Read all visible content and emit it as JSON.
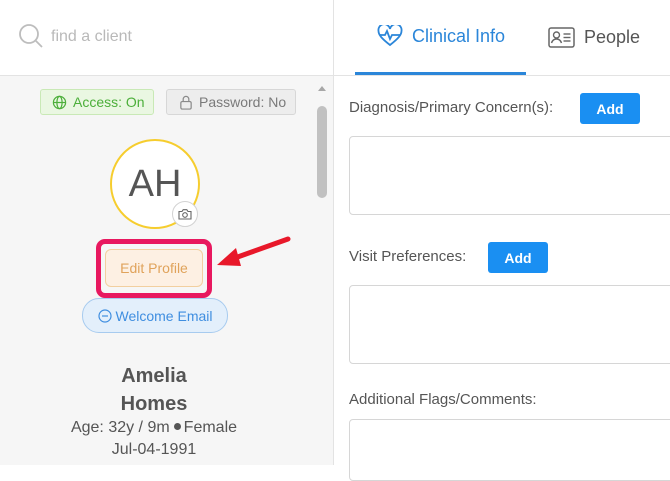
{
  "search": {
    "placeholder": "find a client"
  },
  "badges": {
    "access": "Access: On",
    "password": "Password: No"
  },
  "profile": {
    "initials": "AH",
    "first_name": "Amelia",
    "last_name": "Homes",
    "age_text": "Age: 32y / 9m",
    "gender": "Female",
    "dob": "Jul-04-1991"
  },
  "buttons": {
    "edit_profile": "Edit Profile",
    "welcome_email": "Welcome Email"
  },
  "tabs": [
    {
      "label": "Clinical Info",
      "active": true,
      "icon": "heartbeat-icon"
    },
    {
      "label": "People",
      "active": false,
      "icon": "contact-card-icon"
    }
  ],
  "fields": {
    "diagnosis": {
      "label": "Diagnosis/Primary Concern(s):",
      "button": "Add"
    },
    "visit_preferences": {
      "label": "Visit Preferences:",
      "button": "Add"
    },
    "flags": {
      "label": "Additional Flags/Comments:"
    }
  },
  "colors": {
    "accent": "#1a8ff2",
    "avatar_ring": "#f6cd2e",
    "highlight": "#e8185f",
    "arrow": "#e8182a",
    "access_green": "#4caf3a"
  }
}
